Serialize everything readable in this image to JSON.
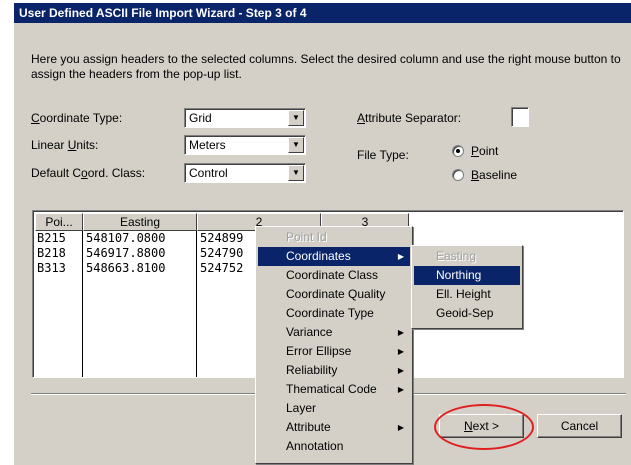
{
  "window": {
    "title": "User Defined ASCII File Import Wizard - Step 3 of 4"
  },
  "description": "Here you assign headers to the selected columns.  Select the desired column and use the right mouse button to assign the headers from the pop-up list.",
  "fields": {
    "coordinate_type": {
      "label_pre": "",
      "label_ul": "C",
      "label_post": "oordinate Type:",
      "value": "Grid"
    },
    "linear_units": {
      "label_pre": "Linear ",
      "label_ul": "U",
      "label_post": "nits:",
      "value": "Meters"
    },
    "default_coord_class": {
      "label_pre": "Default C",
      "label_ul": "o",
      "label_post": "ord. Class:",
      "value": "Control"
    }
  },
  "attribute_separator": {
    "label_pre": "",
    "label_ul": "A",
    "label_post": "ttribute Separator:",
    "value": ""
  },
  "file_type": {
    "label": "File Type:",
    "point": {
      "label_ul": "P",
      "label_post": "oint",
      "selected": true
    },
    "baseline": {
      "label_ul": "B",
      "label_post": "aseline",
      "selected": false
    }
  },
  "grid": {
    "headers": [
      "Poi...",
      "Easting",
      "2",
      "3"
    ],
    "rows": [
      [
        "B215",
        "548107.0800",
        "524899"
      ],
      [
        "B218",
        "546917.8800",
        "524790"
      ],
      [
        "B313",
        "548663.8100",
        "524752"
      ]
    ]
  },
  "context_menu": {
    "items": [
      {
        "label": "Point Id",
        "disabled": true,
        "submenu": false
      },
      {
        "label": "Coordinates",
        "highlighted": true,
        "submenu": true
      },
      {
        "label": "Coordinate Class",
        "submenu": false
      },
      {
        "label": "Coordinate Quality",
        "submenu": false
      },
      {
        "label": "Coordinate Type",
        "submenu": false
      },
      {
        "label": "Variance",
        "submenu": true
      },
      {
        "label": "Error Ellipse",
        "submenu": true
      },
      {
        "label": "Reliability",
        "submenu": true
      },
      {
        "label": "Thematical Code",
        "submenu": true
      },
      {
        "label": "Layer",
        "submenu": false
      },
      {
        "label": "Attribute",
        "submenu": true
      },
      {
        "label": "Annotation",
        "submenu": false
      }
    ]
  },
  "submenu": {
    "items": [
      {
        "label": "Easting",
        "disabled": true
      },
      {
        "label": "Northing",
        "highlighted": true
      },
      {
        "label": "Ell. Height"
      },
      {
        "label": "Geoid-Sep"
      }
    ]
  },
  "buttons": {
    "next": {
      "label_ul": "N",
      "label_post": "ext >"
    },
    "cancel": "Cancel"
  },
  "icons": {
    "dropdown": "chevron-down-icon",
    "submenu": "triangle-right-icon"
  },
  "colors": {
    "title_bar": "#0a246a",
    "highlight": "#0a246a",
    "face": "#d4d0c8",
    "annotation": "#e02020"
  }
}
